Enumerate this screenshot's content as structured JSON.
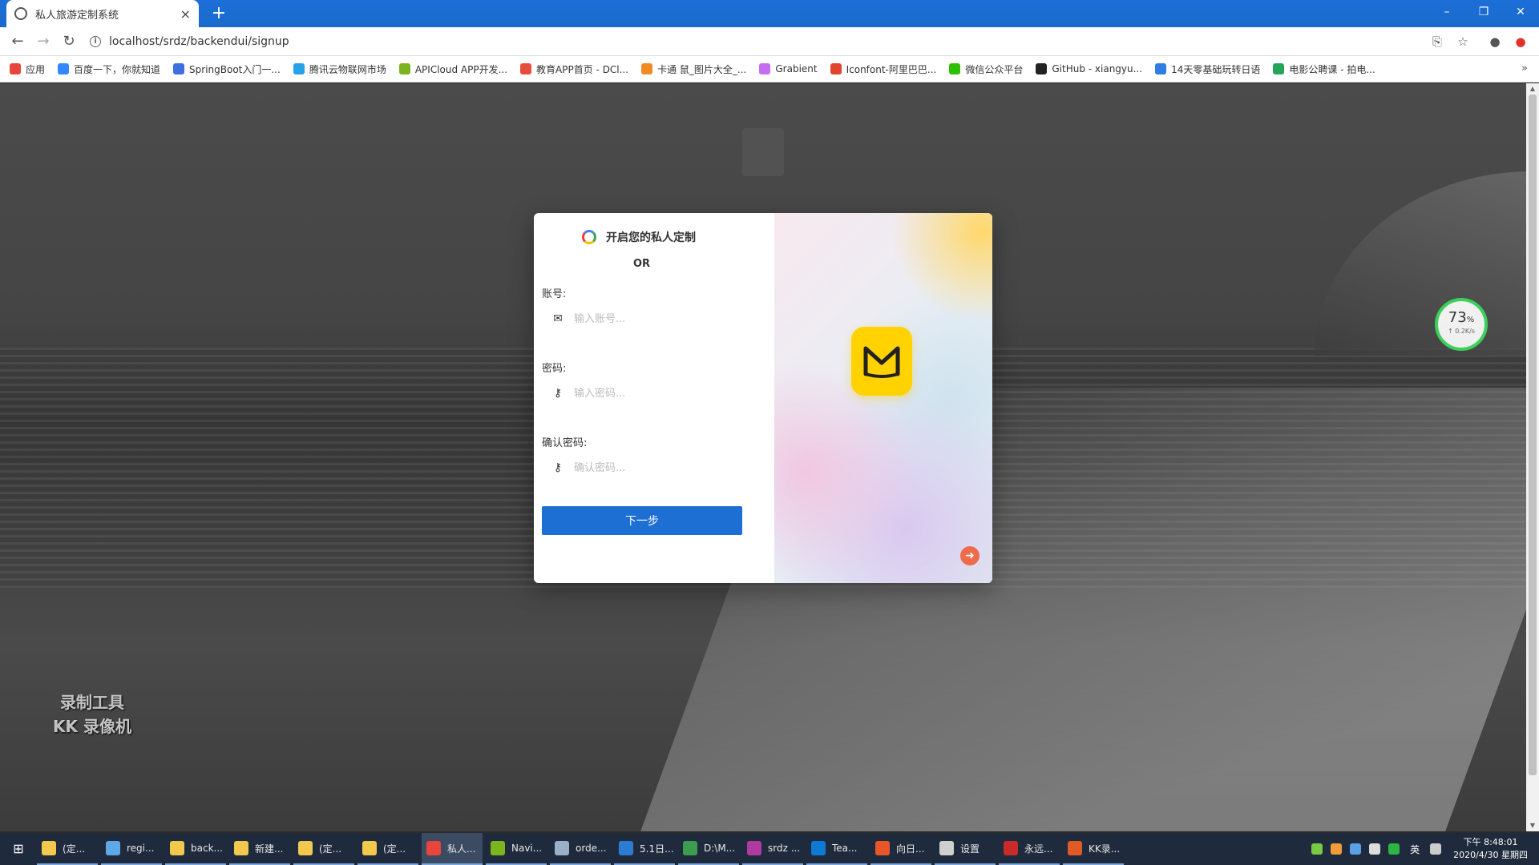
{
  "browser": {
    "tab_title": "私人旅游定制系统",
    "tab_close": "×",
    "new_tab": "+",
    "url": "localhost/srdz/backendui/signup",
    "window_controls": [
      "–",
      "❐",
      "✕"
    ],
    "bookmarks": [
      {
        "label": "应用",
        "color": "#e8453c"
      },
      {
        "label": "百度一下，你就知道",
        "color": "#3388ff"
      },
      {
        "label": "SpringBoot入门一...",
        "color": "#3d6fe0"
      },
      {
        "label": "腾讯云物联网市场",
        "color": "#27a2e8"
      },
      {
        "label": "APICloud APP开发...",
        "color": "#7ab51d"
      },
      {
        "label": "教育APP首页 - DCl...",
        "color": "#e84c3d"
      },
      {
        "label": "卡通 鼠_图片大全_...",
        "color": "#f08a24"
      },
      {
        "label": "Grabient",
        "color": "#c56cf0"
      },
      {
        "label": "Iconfont-阿里巴巴...",
        "color": "#e0452d"
      },
      {
        "label": "微信公众平台",
        "color": "#2dc100"
      },
      {
        "label": "GitHub - xiangyu...",
        "color": "#222222"
      },
      {
        "label": "14天零基础玩转日语",
        "color": "#2f7de1"
      },
      {
        "label": "电影公聘课 - 拍电...",
        "color": "#25a55a"
      }
    ],
    "bookmarks_more": "»"
  },
  "card": {
    "title": "开启您的私人定制",
    "or_text": "OR",
    "account_label": "账号:",
    "account_placeholder": "输入账号...",
    "password_label": "密码:",
    "password_placeholder": "输入密码...",
    "confirm_label": "确认密码:",
    "confirm_placeholder": "确认密码...",
    "next_button": "下一步",
    "arrow": "➜"
  },
  "speed_widget": {
    "percent": "73",
    "unit": "%",
    "rate": "↑ 0.2K/s"
  },
  "watermark": {
    "line1": "录制工具",
    "line2": "KK 录像机"
  },
  "taskbar": {
    "items": [
      {
        "label": "(定...",
        "color": "#f2c94c"
      },
      {
        "label": "regi...",
        "color": "#5fa8e8"
      },
      {
        "label": "back...",
        "color": "#f2c94c"
      },
      {
        "label": "新建...",
        "color": "#f2c94c"
      },
      {
        "label": "(定...",
        "color": "#f2c94c"
      },
      {
        "label": "(定...",
        "color": "#f2c94c"
      },
      {
        "label": "私人...",
        "color": "#e8453c",
        "active": true
      },
      {
        "label": "Navi...",
        "color": "#7ab51d"
      },
      {
        "label": "orde...",
        "color": "#9ab0c8"
      },
      {
        "label": "5.1日...",
        "color": "#2b7cd3"
      },
      {
        "label": "D:\\M...",
        "color": "#3c9d4f"
      },
      {
        "label": "srdz ...",
        "color": "#b03aa0"
      },
      {
        "label": "Tea...",
        "color": "#0e7ad4"
      },
      {
        "label": "向日...",
        "color": "#e8562a"
      },
      {
        "label": "设置",
        "color": "#cfcfcf"
      },
      {
        "label": "永远...",
        "color": "#c92a2a"
      },
      {
        "label": "KK录...",
        "color": "#e05a26"
      }
    ],
    "ime": "英",
    "time": "下午 8:48:01",
    "date": "2020/4/30 星期四"
  }
}
